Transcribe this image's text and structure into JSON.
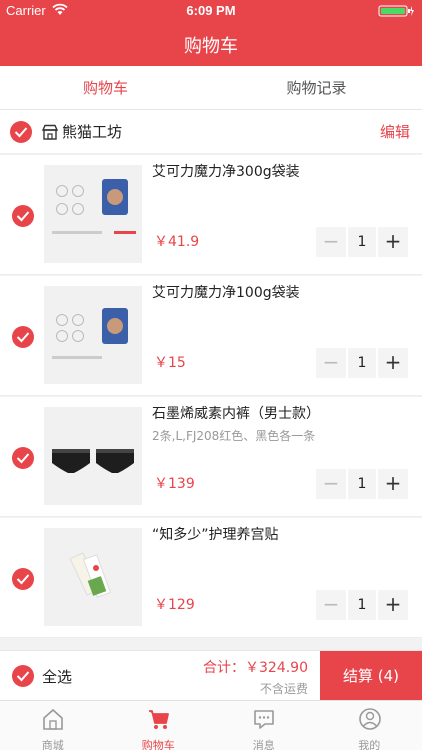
{
  "status": {
    "carrier": "Carrier",
    "time": "6:09 PM"
  },
  "nav": {
    "title": "购物车"
  },
  "segments": {
    "active": "购物车",
    "inactive": "购物记录"
  },
  "store": {
    "name": "熊猫工坊",
    "edit": "编辑"
  },
  "items": [
    {
      "name": "艾可力魔力净300g袋装",
      "spec": "",
      "price": "￥41.9",
      "qty": "1"
    },
    {
      "name": "艾可力魔力净100g袋装",
      "spec": "",
      "price": "￥15",
      "qty": "1"
    },
    {
      "name": "石墨烯威素内裤（男士款）",
      "spec": "2条,L,FJ208红色、黑色各一条",
      "price": "￥139",
      "qty": "1"
    },
    {
      "name": "“知多少”护理养宫贴",
      "spec": "",
      "price": "￥129",
      "qty": "1"
    }
  ],
  "stepper": {
    "minus": "−",
    "plus": "+"
  },
  "checkout": {
    "select_all": "全选",
    "total": "合计：￥324.90",
    "shipping": "不含运费",
    "settle": "结算 (4)"
  },
  "tabs": [
    {
      "label": "商城",
      "icon": "home-icon"
    },
    {
      "label": "购物车",
      "icon": "cart-icon"
    },
    {
      "label": "消息",
      "icon": "message-icon"
    },
    {
      "label": "我的",
      "icon": "user-icon"
    }
  ],
  "colors": {
    "accent": "#e8454b"
  }
}
